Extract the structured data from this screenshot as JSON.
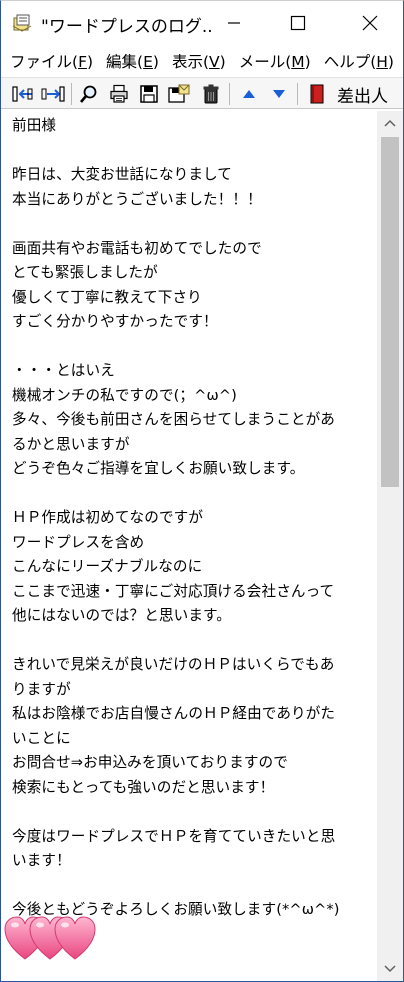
{
  "window": {
    "title": "\"ワードプレスのログ...",
    "minimize_glyph": "—",
    "close_glyph": "✕"
  },
  "menu": {
    "items": [
      {
        "label": "ファイル(",
        "accel": "F",
        "tail": ")"
      },
      {
        "label": "編集(",
        "accel": "E",
        "tail": ")"
      },
      {
        "label": "表示(",
        "accel": "V",
        "tail": ")"
      },
      {
        "label": "メール(",
        "accel": "M",
        "tail": ")"
      },
      {
        "label": "ヘルプ(",
        "accel": "H",
        "tail": ")"
      }
    ]
  },
  "toolbar": {
    "icons": [
      "prev-message-icon",
      "next-message-icon",
      "search-icon",
      "print-icon",
      "save-icon",
      "save-attachment-icon",
      "delete-icon",
      "up-arrow-icon",
      "down-arrow-icon",
      "sender-book-icon"
    ],
    "sender_label": "差出人"
  },
  "message": {
    "lines": [
      "前田様",
      "",
      "昨日は、大変お世話になりまして",
      "本当にありがとうございました！！！",
      "",
      "画面共有やお電話も初めてでしたので",
      "とても緊張しましたが",
      "優しくて丁寧に教えて下さり",
      "すごく分かりやすかったです！",
      "",
      "・・・とはいえ",
      "機械オンチの私ですので(；^ω^)",
      "多々、今後も前田さんを困らせてしまうことがあ",
      "るかと思いますが",
      "どうぞ色々ご指導を宜しくお願い致します。",
      "",
      "ＨＰ作成は初めてなのですが",
      "ワードプレスを含め",
      "こんなにリーズナブルなのに",
      "ここまで迅速・丁寧にご対応頂ける会社さんって",
      "他にはないのでは？と思います。",
      "",
      "きれいで見栄えが良いだけのＨＰはいくらでもあ",
      "りますが",
      "私はお陰様でお店自慢さんのＨＰ経由でありがた",
      "いことに",
      "お問合せ⇒お申込みを頂いておりますので",
      "検索にもとっても強いのだと思います！",
      "",
      "今度はワードプレスでＨＰを育てていきたいと思",
      "います！",
      "",
      "今後ともどうぞよろしくお願い致します(*^ω^*)"
    ],
    "emoji": "hearts-icon"
  },
  "colors": {
    "toolbar_arrow_blue": "#1a5fd6",
    "heart_pink": "#f06fa0",
    "scroll_thumb": "#c2c2c2"
  }
}
